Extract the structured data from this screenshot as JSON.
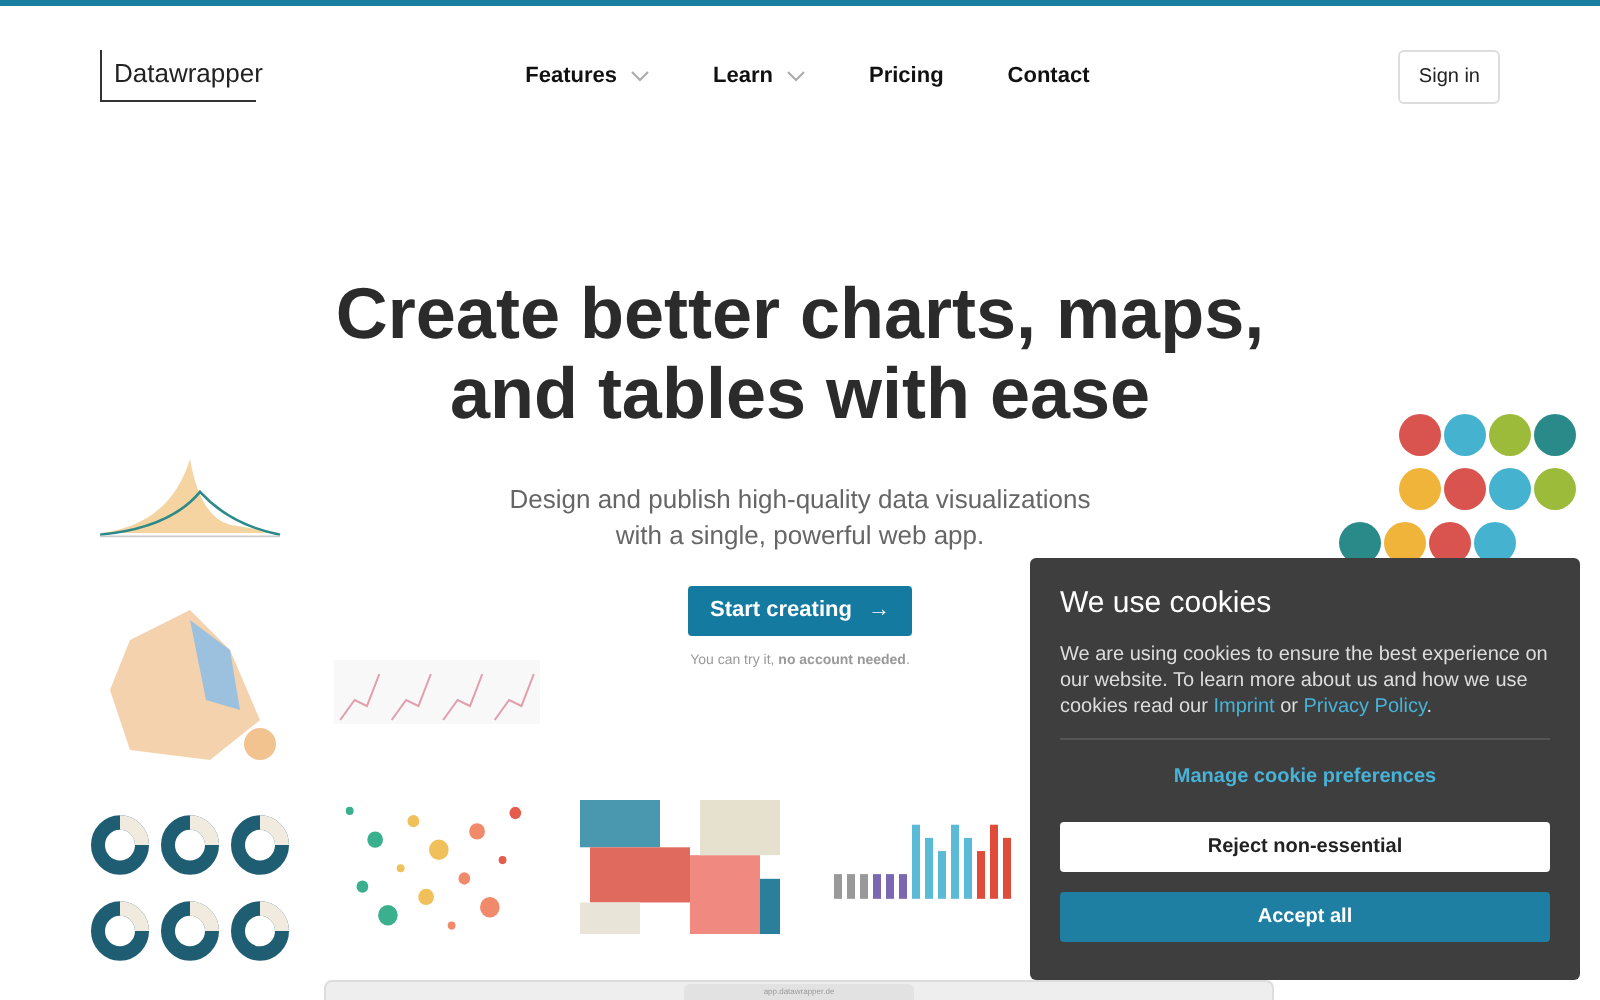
{
  "header": {
    "logo": "Datawrapper",
    "nav": [
      {
        "label": "Features",
        "dropdown": true
      },
      {
        "label": "Learn",
        "dropdown": true
      },
      {
        "label": "Pricing",
        "dropdown": false
      },
      {
        "label": "Contact",
        "dropdown": false
      }
    ],
    "sign_in": "Sign in"
  },
  "hero": {
    "title_lines": [
      "Create better charts, maps,",
      "and tables with ease"
    ],
    "subtitle_lines": [
      "Design and publish high-quality data visualizations",
      "with a single, powerful web app."
    ],
    "cta": "Start creating",
    "cta_icon": "→",
    "note": "You can try it, **no account needed**."
  },
  "browser_preview": {
    "address": "app.datawrapper.de"
  },
  "cookie_banner": {
    "title": "We use cookies",
    "text_before": "We are using cookies to ensure the best experience on our website. To learn more about us and how we use cookies read our",
    "link_1": "Imprint",
    "text_middle": "or",
    "link_2": "Privacy Policy",
    "text_after": ".",
    "manage": "Manage cookie preferences",
    "reject": "Reject non-essential",
    "accept": "Accept all"
  }
}
